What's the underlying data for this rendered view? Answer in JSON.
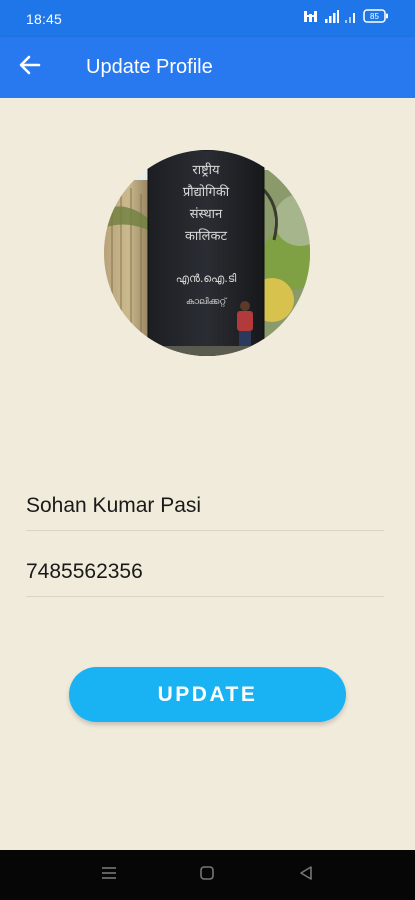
{
  "status_bar": {
    "time": "18:45",
    "icons": [
      "hd-signal-icon",
      "signal-icon",
      "wifi-icon",
      "battery-icon"
    ],
    "battery_level": "85"
  },
  "app_bar": {
    "title": "Update Profile",
    "back_icon": "arrow-left-icon",
    "color": "#2878f0"
  },
  "profile": {
    "photo_text": {
      "line1": "राष्ट्रीय",
      "line2": "प्रौद्योगिकी",
      "line3": "संस्थान",
      "line4": "कालिकट",
      "line5": "എൻ.ഐ.ടി",
      "line6": "കാലിക്കറ്റ്"
    }
  },
  "form": {
    "name_value": "Sohan Kumar Pasi",
    "phone_value": "7485562356"
  },
  "update_button": {
    "label": "UPDATE",
    "color": "#19b2f2"
  },
  "nav_bar": {
    "icons": [
      "menu-icon",
      "home-icon",
      "back-triangle-icon"
    ]
  }
}
